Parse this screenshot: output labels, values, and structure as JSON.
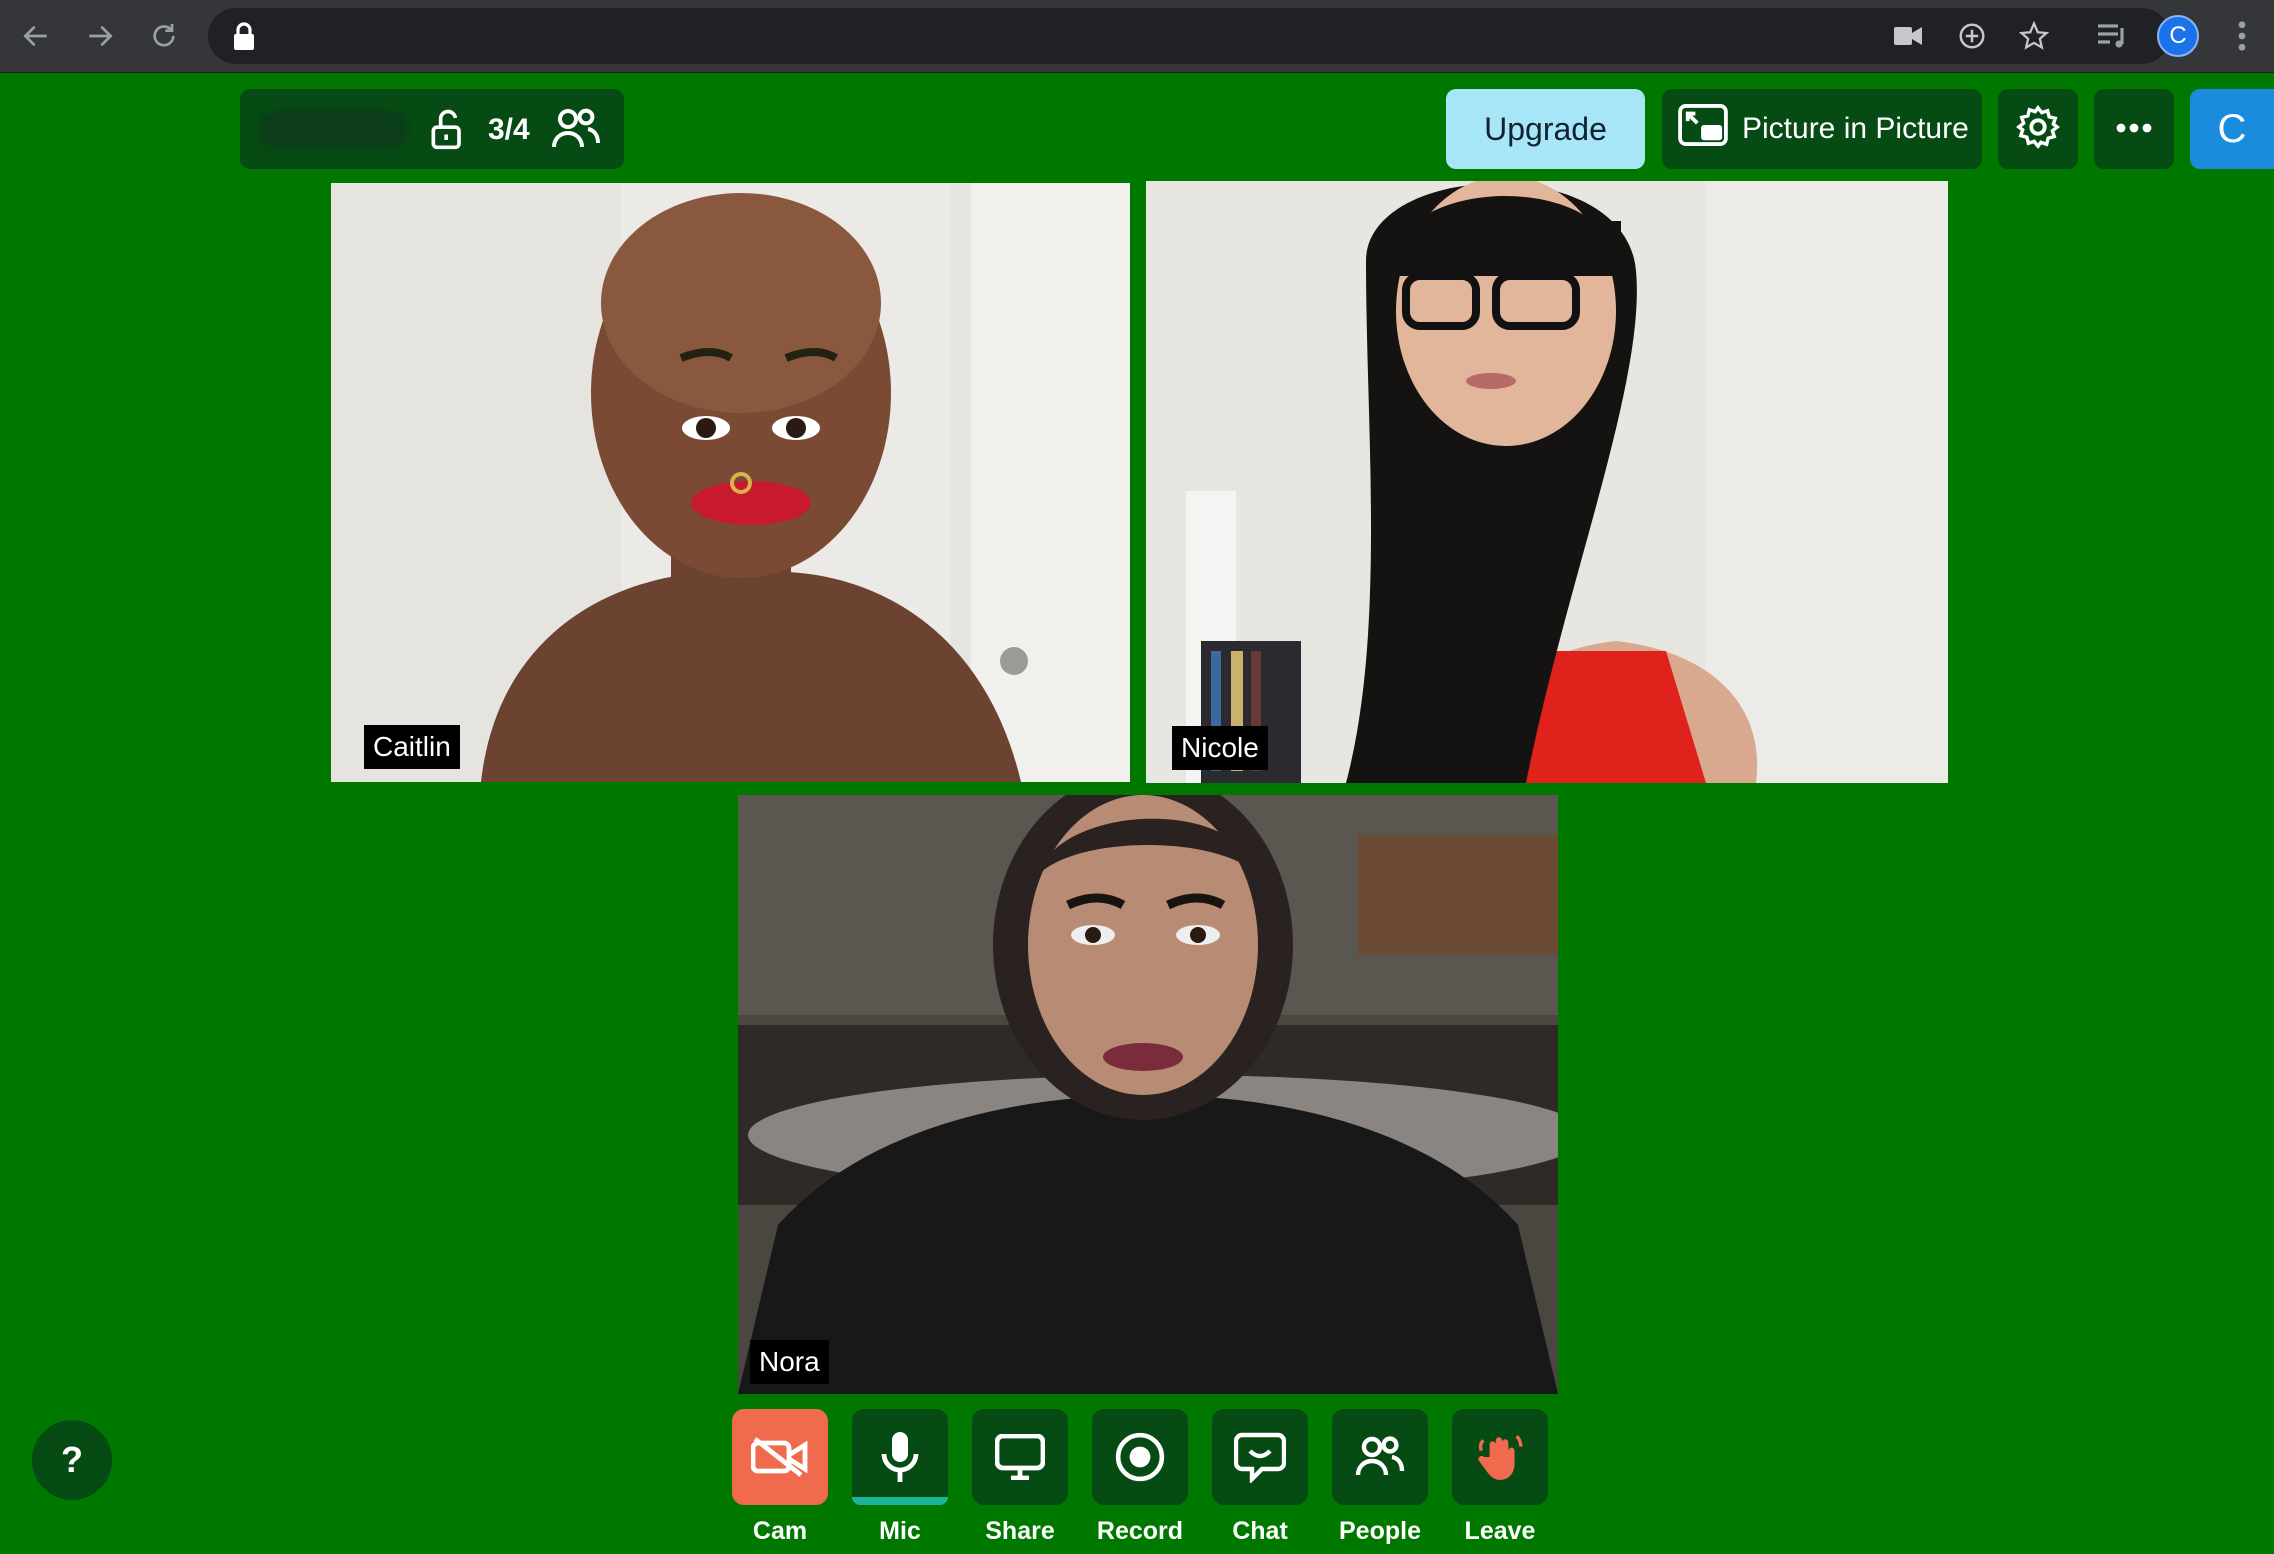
{
  "browser": {
    "address": "",
    "icons": [
      "back-icon",
      "forward-icon",
      "reload-icon",
      "lock-icon",
      "camera-icon",
      "zoom-icon",
      "star-icon",
      "media-icon",
      "menu-icon"
    ],
    "profile_initial": "C"
  },
  "room": {
    "count": "3/4",
    "lock_state": "unlocked"
  },
  "topbar": {
    "upgrade_label": "Upgrade",
    "pip_label": "Picture in Picture",
    "avatar_initial": "C"
  },
  "participants": [
    {
      "name": "Caitlin"
    },
    {
      "name": "Nicole"
    },
    {
      "name": "Nora"
    }
  ],
  "controls": [
    {
      "label": "Cam",
      "state": "off",
      "color": "#f06a4d"
    },
    {
      "label": "Mic",
      "state": "on"
    },
    {
      "label": "Share"
    },
    {
      "label": "Record"
    },
    {
      "label": "Chat"
    },
    {
      "label": "People"
    },
    {
      "label": "Leave"
    }
  ],
  "help_label": "?",
  "colors": {
    "background": "#007800",
    "button_dark": "#064a14",
    "upgrade": "#a7e6f6",
    "cam_off": "#f06a4d",
    "avatar": "#1a8cde"
  }
}
